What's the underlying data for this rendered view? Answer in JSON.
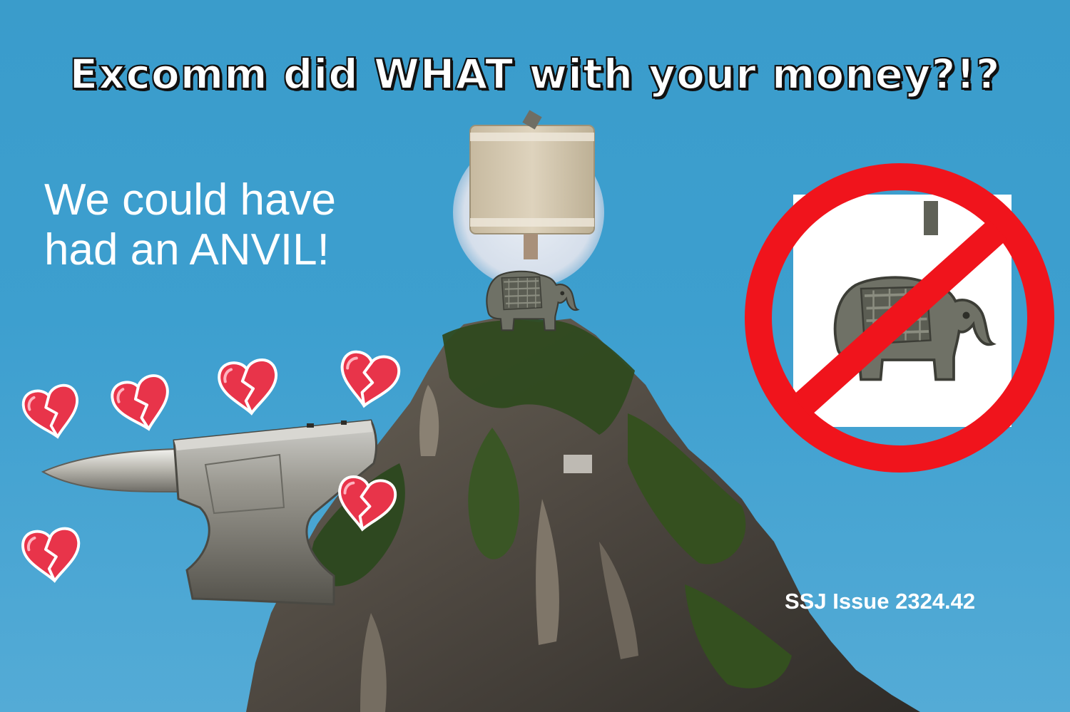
{
  "poster": {
    "headline": "Excomm did WHAT with your money?!?",
    "subtext_line1": "We could have",
    "subtext_line2": "had an ANVIL!",
    "issue_label": "SSJ Issue 2324.42"
  },
  "colors": {
    "sky": "#3d9fcf",
    "headline_fill": "#ffffff",
    "headline_outline": "#111111",
    "prohibition_red": "#f0141c",
    "heart_red": "#e8344a"
  },
  "icons": {
    "heart": "broken-heart-icon",
    "prohibition": "prohibition-sign-icon"
  }
}
